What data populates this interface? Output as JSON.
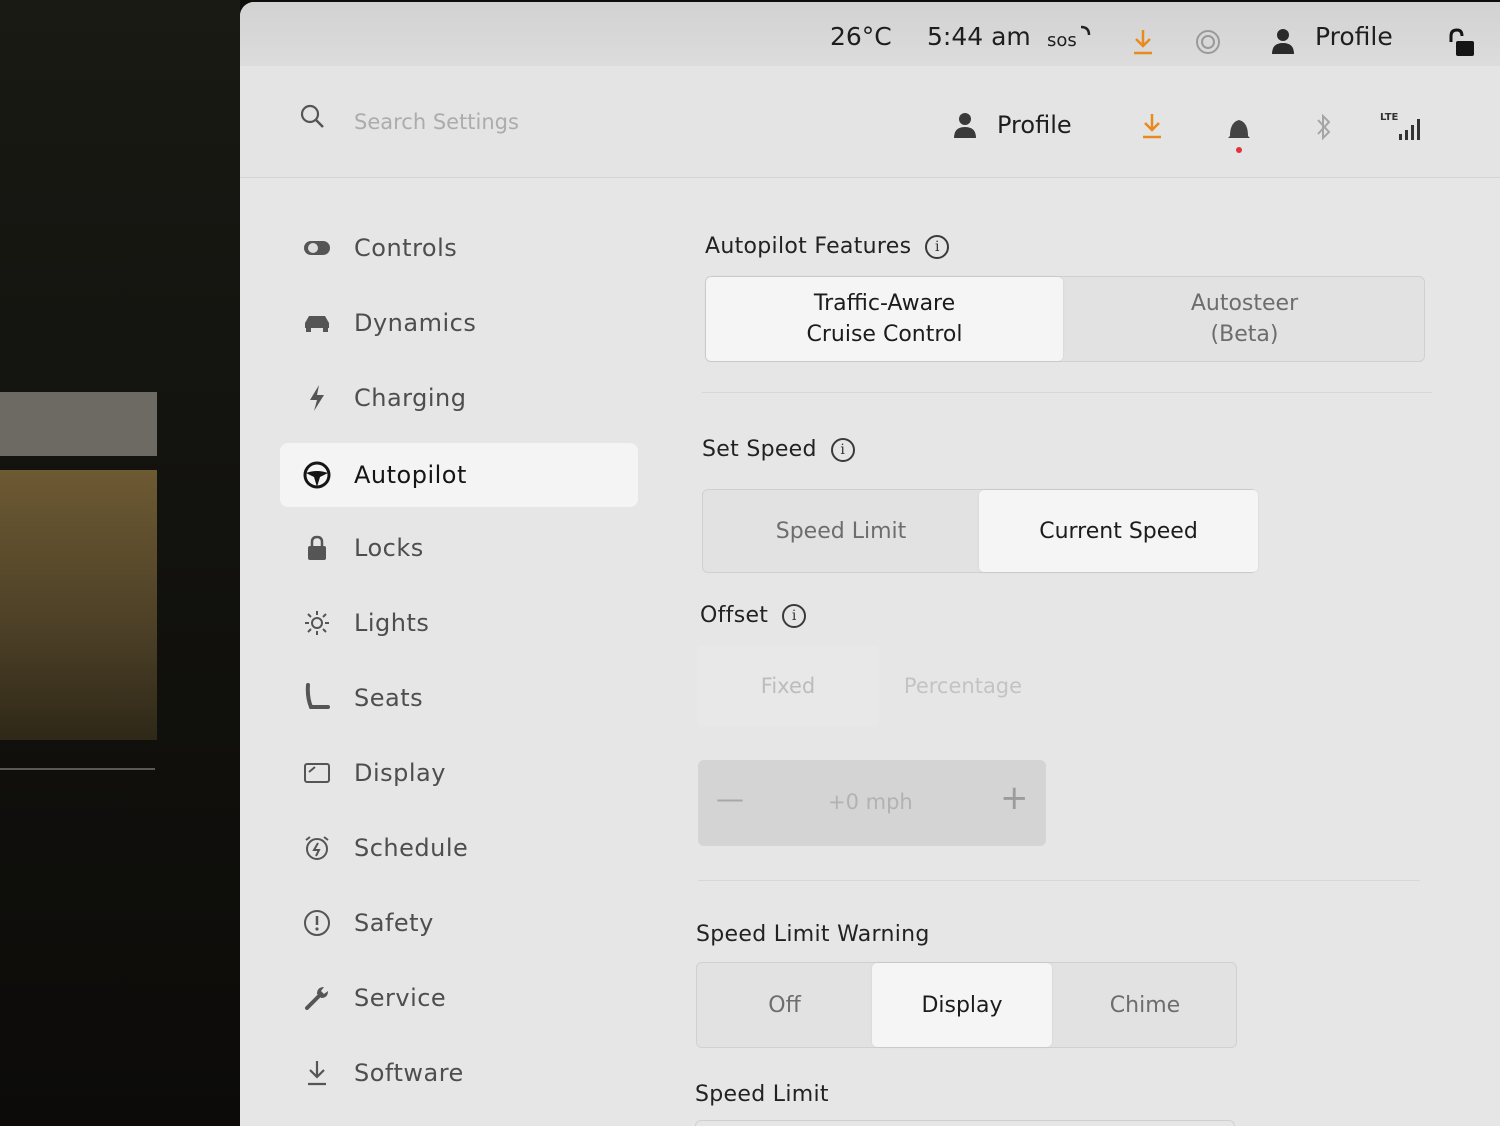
{
  "status_bar": {
    "temperature": "26°C",
    "time": "5:44 am",
    "sos": "sos",
    "profile_label": "Profile"
  },
  "header": {
    "search_placeholder": "Search Settings",
    "profile_label": "Profile",
    "signal_label": "LTE"
  },
  "sidebar": {
    "items": [
      {
        "label": "Controls"
      },
      {
        "label": "Dynamics"
      },
      {
        "label": "Charging"
      },
      {
        "label": "Autopilot"
      },
      {
        "label": "Locks"
      },
      {
        "label": "Lights"
      },
      {
        "label": "Seats"
      },
      {
        "label": "Display"
      },
      {
        "label": "Schedule"
      },
      {
        "label": "Safety"
      },
      {
        "label": "Service"
      },
      {
        "label": "Software"
      }
    ],
    "active": "Autopilot"
  },
  "autopilot_features": {
    "title": "Autopilot Features",
    "options": [
      {
        "line1": "Traffic-Aware",
        "line2": "Cruise Control"
      },
      {
        "line1": "Autosteer",
        "line2": "(Beta)"
      }
    ],
    "selected": "Traffic-Aware Cruise Control"
  },
  "set_speed": {
    "title": "Set Speed",
    "options": [
      "Speed Limit",
      "Current Speed"
    ],
    "selected": "Current Speed"
  },
  "offset": {
    "title": "Offset",
    "options": [
      "Fixed",
      "Percentage"
    ],
    "value": "+0 mph",
    "minus": "—",
    "plus": "+"
  },
  "speed_limit_warning": {
    "title": "Speed Limit Warning",
    "options": [
      "Off",
      "Display",
      "Chime"
    ],
    "selected": "Display"
  },
  "speed_limit": {
    "title": "Speed Limit"
  },
  "colors": {
    "accent_orange": "#e98a1c",
    "notification_red": "#e0343a",
    "background": "#e6e6e6",
    "selected_bg": "#f5f5f5"
  }
}
